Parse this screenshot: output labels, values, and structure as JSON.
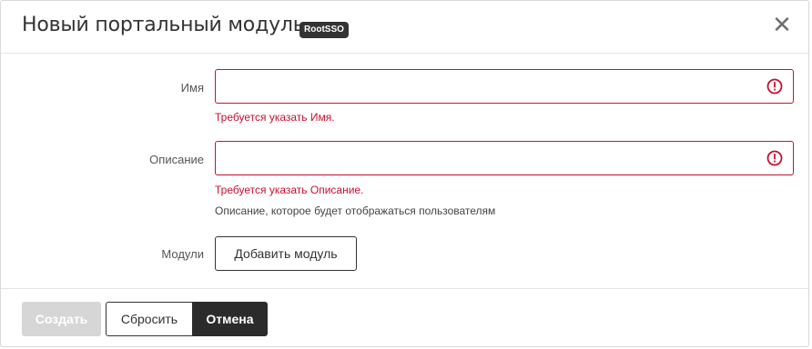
{
  "dialog": {
    "title": "Новый портальный модуль",
    "badge": "RootSSO",
    "close_icon": "close-icon"
  },
  "form": {
    "name": {
      "label": "Имя",
      "value": "",
      "error": "Требуется указать Имя.",
      "status_icon": "error-circle-icon"
    },
    "description": {
      "label": "Описание",
      "value": "",
      "error": "Требуется указать Описание.",
      "help": "Описание, которое будет отображаться пользователям",
      "status_icon": "error-circle-icon"
    },
    "modules": {
      "label": "Модули",
      "add_button": "Добавить модуль"
    }
  },
  "footer": {
    "create_label": "Создать",
    "reset_label": "Сбросить",
    "cancel_label": "Отмена"
  },
  "colors": {
    "error": "#c8102e",
    "dark": "#2b2b2b",
    "disabled": "#d6d6d6"
  }
}
